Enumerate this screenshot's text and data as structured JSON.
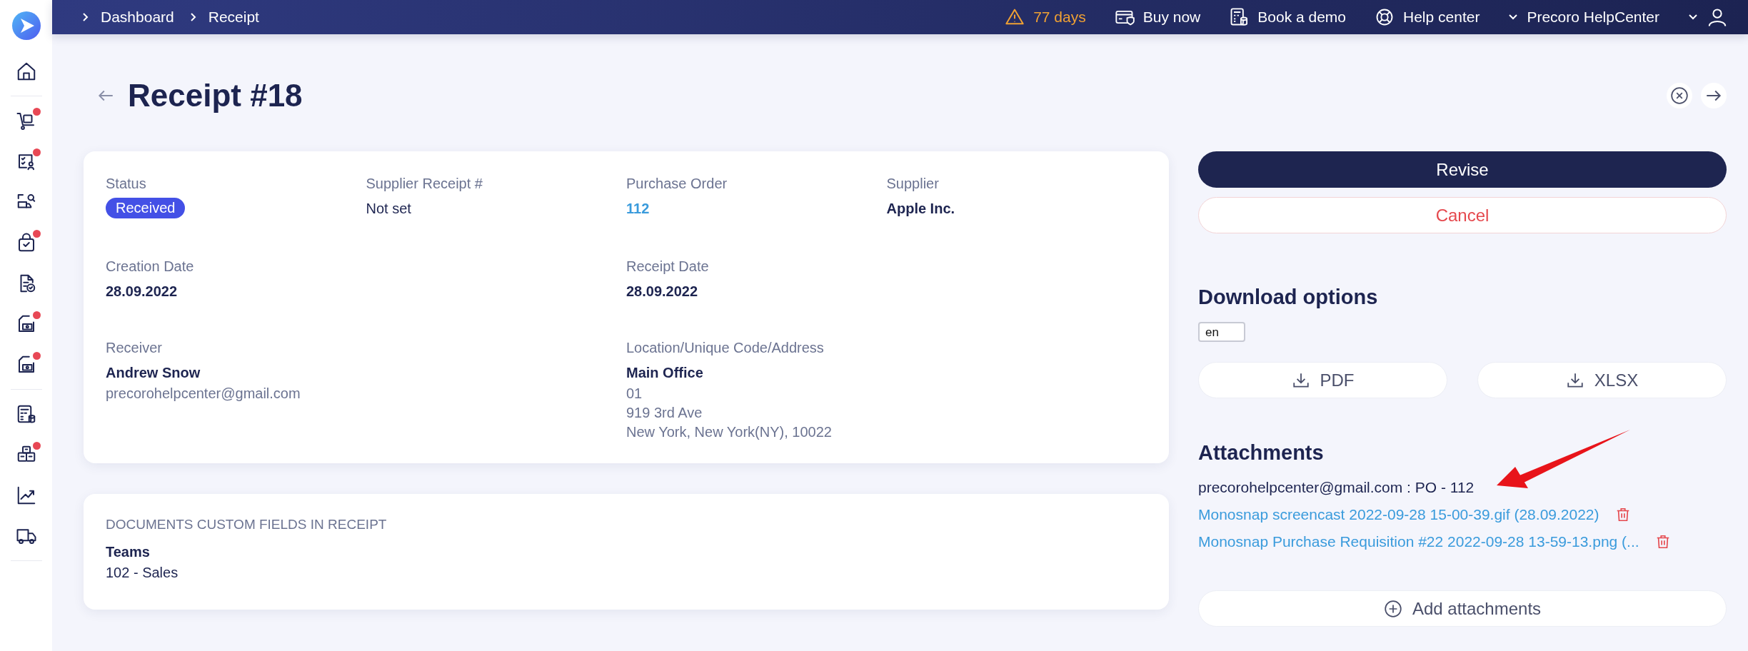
{
  "sidebar": {
    "groups": [
      {
        "items": [
          {
            "notification": false
          }
        ]
      },
      {
        "items": [
          {
            "notification": true
          },
          {
            "notification": true
          },
          {
            "notification": false
          },
          {
            "notification": true
          },
          {
            "notification": false
          },
          {
            "notification": true
          },
          {
            "notification": true
          }
        ]
      },
      {
        "items": [
          {
            "notification": false
          },
          {
            "notification": true
          },
          {
            "notification": false
          },
          {
            "notification": false
          }
        ]
      }
    ]
  },
  "topbar": {
    "breadcrumbs": [
      "Dashboard",
      "Receipt"
    ],
    "trial": "77 days",
    "links": [
      "Buy now",
      "Book a demo",
      "Help center"
    ],
    "company": "Precoro HelpCenter"
  },
  "title": "Receipt #18",
  "details": {
    "rows": [
      {
        "fields": [
          {
            "label": "Status",
            "kind": "badge",
            "value": "Received"
          },
          {
            "label": "Supplier Receipt #",
            "kind": "text",
            "value": "Not set"
          },
          {
            "label": "Purchase Order",
            "kind": "link",
            "value": "112"
          },
          {
            "label": "Supplier",
            "kind": "bold",
            "value": "Apple Inc."
          }
        ]
      },
      {
        "fields": [
          {
            "label": "Creation Date",
            "kind": "bold",
            "value": "28.09.2022"
          },
          {
            "label": "Receipt Date",
            "kind": "bold",
            "value": "28.09.2022"
          }
        ]
      },
      {
        "fields": [
          {
            "label": "Receiver",
            "kind": "bold",
            "value": "Andrew Snow",
            "details": [
              "precorohelpcenter@gmail.com"
            ]
          },
          {
            "label": "Location/Unique Code/Address",
            "kind": "bold",
            "value": "Main Office",
            "details": [
              "01",
              "919 3rd Ave",
              "New York, New York(NY), 10022"
            ]
          }
        ]
      }
    ]
  },
  "custom_fields": {
    "heading": "DOCUMENTS CUSTOM FIELDS IN RECEIPT",
    "fields": [
      {
        "label": "Teams",
        "value": "102 - Sales"
      }
    ]
  },
  "actions": [
    {
      "label": "Revise",
      "kind": "primary"
    },
    {
      "label": "Cancel",
      "kind": "danger"
    }
  ],
  "download": {
    "heading": "Download options",
    "language": "en",
    "buttons": [
      "PDF",
      "XLSX"
    ]
  },
  "attachments": {
    "heading": "Attachments",
    "note": "precorohelpcenter@gmail.com : PO - 112",
    "files": [
      "Monosnap screencast 2022-09-28 15-00-39.gif (28.09.2022)",
      "Monosnap Purchase Requisition #22 2022-09-28 13-59-13.png (..."
    ],
    "add_button": "Add attachments"
  }
}
